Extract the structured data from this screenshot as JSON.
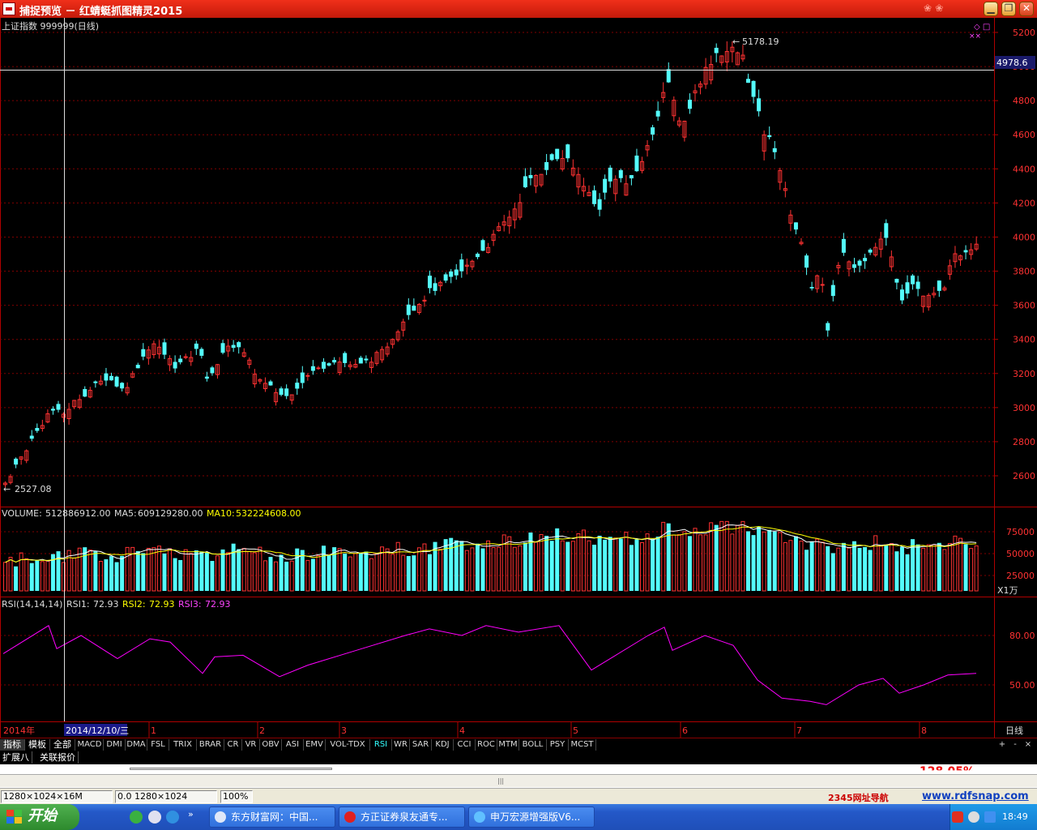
{
  "window": {
    "title": "捕捉预览 － 红蜻蜓抓图精灵2015",
    "minimize_glyph": "▁",
    "restore_glyph": "❐",
    "close_glyph": "✕"
  },
  "kline": {
    "header": "上证指数 999999(日线)",
    "high_label": "5178.19",
    "low_label": "2527.08",
    "crosshair_value": "4978.6",
    "mark_symbols": "◇ □",
    "mark_symbols2": "××",
    "y_ticks": [
      "5200",
      "5000",
      "4800",
      "4600",
      "4400",
      "4200",
      "4000",
      "3800",
      "3600",
      "3400",
      "3200",
      "3000",
      "2800",
      "2600"
    ]
  },
  "volume": {
    "label": "VOLUME:",
    "value": "512886912.00",
    "ma5_label": "MA5:",
    "ma5_value": "609129280.00",
    "ma10_label": "MA10:",
    "ma10_value": "532224608.00",
    "y_ticks": [
      "75000",
      "50000",
      "25000"
    ],
    "unit": "X1万"
  },
  "rsi": {
    "label": "RSI(14,14,14)",
    "rsi1_label": "RSI1:",
    "rsi1_value": "72.93",
    "rsi2_label": "RSI2:",
    "rsi2_value": "72.93",
    "rsi3_label": "RSI3:",
    "rsi3_value": "72.93",
    "y_ticks": [
      "80.00",
      "50.00"
    ]
  },
  "time_axis": {
    "year_label": "2014年",
    "cursor_date": "2014/12/10/三",
    "months": [
      "1",
      "2",
      "3",
      "4",
      "5",
      "6",
      "7",
      "8"
    ],
    "period": "日线"
  },
  "indicator_tabs": {
    "cn_tabs": [
      "指标",
      "模板",
      "全部"
    ],
    "tabs": [
      "MACD",
      "DMI",
      "DMA",
      "FSL",
      "TRIX",
      "BRAR",
      "CR",
      "VR",
      "OBV",
      "ASI",
      "EMV",
      "VOL-TDX",
      "RSI",
      "WR",
      "SAR",
      "KDJ",
      "CCI",
      "ROC",
      "MTM",
      "BOLL",
      "PSY",
      "MCST"
    ],
    "active": "RSI",
    "right_controls": [
      "+",
      "-",
      "×"
    ]
  },
  "ext_tabs": [
    "扩展八",
    "关联报价"
  ],
  "lower_peek": "128.05%",
  "statusbar": {
    "dims": "1280×1024×16M",
    "coords": "0.0 1280×1024",
    "zoom": "100%",
    "nav": "2345网址导航",
    "url": "www.rdfsnap.com"
  },
  "taskbar": {
    "start_label": "开始",
    "tasks": [
      "东方财富网：中国...",
      "方正证券泉友通专...",
      "申万宏源增强版V6..."
    ],
    "clock": "18:49"
  },
  "colors": {
    "up": "#ff3232",
    "down": "#54fcfc",
    "ma5": "#ffffff",
    "ma10": "#ffff00",
    "rsi": "#ff00ff",
    "axis": "#b00000",
    "grid": "#800000"
  },
  "chart_data": {
    "type": "candlestick",
    "series_anchor_closes": [
      [
        2014.12,
        2527
      ],
      [
        2015.01,
        3300
      ],
      [
        2015.02,
        3120
      ],
      [
        2015.03,
        3300
      ],
      [
        2015.04,
        4300
      ],
      [
        2015.05,
        4500
      ],
      [
        2015.06,
        5178
      ],
      [
        2015.07,
        3700
      ],
      [
        2015.08,
        3900
      ]
    ],
    "y_range": [
      2527.08,
      5178.19
    ],
    "rsi_range": [
      30,
      90
    ]
  }
}
